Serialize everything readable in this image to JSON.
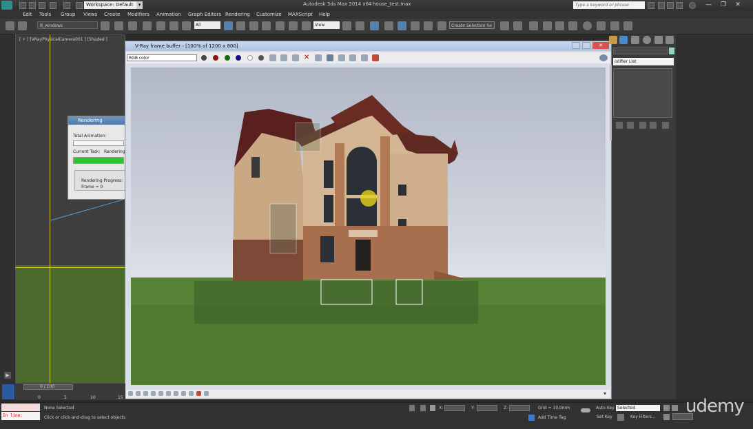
{
  "app": {
    "title": "Autodesk 3ds Max 2014 x64",
    "file": "house_test.max",
    "workspace": "Workspace: Default",
    "workspace_arrow": "▾",
    "help_search_placeholder": "Type a keyword or phrase",
    "window_controls": [
      "—",
      "❐",
      "✕"
    ]
  },
  "menu": [
    "Edit",
    "Tools",
    "Group",
    "Views",
    "Create",
    "Modifiers",
    "Animation",
    "Graph Editors",
    "Rendering",
    "Customize",
    "MAXScript",
    "Help"
  ],
  "toolbar": {
    "selection_sets": "B_windows",
    "selection_filter": "All",
    "ref_coord": "View",
    "create_selection_set": "Create Selection Se"
  },
  "viewport": {
    "label": "[ + ] [VRayPhysicalCamera001 ] [Shaded ]"
  },
  "render_dialog": {
    "title": "Rendering",
    "total_animation": "Total Animation:",
    "current_task": "Current Task:",
    "current_task_value": "Rendering",
    "progress_label": "Rendering Progress:",
    "frame_label": "Frame = 0",
    "current_progress": 1.0
  },
  "vfb": {
    "title": "V-Ray frame buffer - [100% of 1200 x 800]",
    "channel": "RGB color",
    "close": "✕"
  },
  "command_panel": {
    "modifier_list": "odifier List"
  },
  "timeline": {
    "frame": "0 / 100",
    "ticks": [
      "0",
      "5",
      "10",
      "15"
    ]
  },
  "status": {
    "maxscript": "In line:",
    "selection": "None Selected",
    "prompt": "Click or click-and-drag to select objects",
    "grid": "Grid = 10,0mm",
    "add_time_tag": "Add Time Tag",
    "auto_key": "Auto Key",
    "set_key": "Set Key",
    "key_mode": "Selected",
    "key_filters": "Key Filters...",
    "x_label": "X:",
    "y_label": "Y:",
    "z_label": "Z:"
  },
  "watermark": "udemy"
}
